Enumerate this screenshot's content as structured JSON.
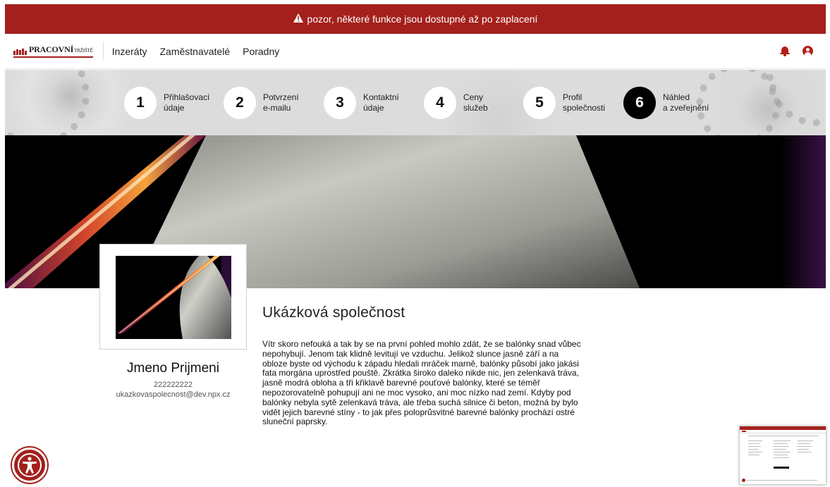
{
  "banner": {
    "icon": "warning-icon",
    "text": "pozor, některé funkce jsou dostupné až po zaplacení"
  },
  "brand": {
    "logo_main": "PRACOVNÍ",
    "logo_small": "TRŽIŠTĚ"
  },
  "nav": {
    "items": [
      "Inzeráty",
      "Zaměstnavatelé",
      "Poradny"
    ]
  },
  "steps": [
    {
      "num": "1",
      "line1": "Přihlašovací",
      "line2": "údaje",
      "active": false
    },
    {
      "num": "2",
      "line1": "Potvrzení",
      "line2": "e-mailu",
      "active": false
    },
    {
      "num": "3",
      "line1": "Kontaktní",
      "line2": "údaje",
      "active": false
    },
    {
      "num": "4",
      "line1": "Ceny",
      "line2": "služeb",
      "active": false
    },
    {
      "num": "5",
      "line1": "Profil",
      "line2": "společnosti",
      "active": false
    },
    {
      "num": "6",
      "line1": "Náhled",
      "line2": "a zveřejnění",
      "active": true
    }
  ],
  "profile": {
    "name": "Jmeno Prijmeni",
    "phone": "222222222",
    "email": "ukazkovaspolecnost@dev.npx.cz"
  },
  "company": {
    "title": "Ukázková společnost",
    "description": "Vítr skoro nefouká a tak by se na první pohled mohlo zdát, že se balónky snad vůbec nepohybují. Jenom tak klidně levitují ve vzduchu. Jelikož slunce jasně září a na obloze byste od východu k západu hledali mráček marně, balónky působí jako jakási fata morgána uprostřed pouště. Zkrátka široko daleko nikde nic, jen zelenkavá tráva, jasně modrá obloha a tři křiklavě barevné pouťové balónky, které se téměř nepozorovatelně pohupují ani ne moc vysoko, ani moc nízko nad zemí. Kdyby pod balónky nebyla sytě zelenkavá tráva, ale třeba suchá silnice či beton, možná by bylo vidět jejich barevné stíny - to jak přes poloprůsvitné barevné balónky prochází ostré sluneční paprsky."
  },
  "colors": {
    "brand": "#a3201c",
    "active_step": "#000000"
  }
}
